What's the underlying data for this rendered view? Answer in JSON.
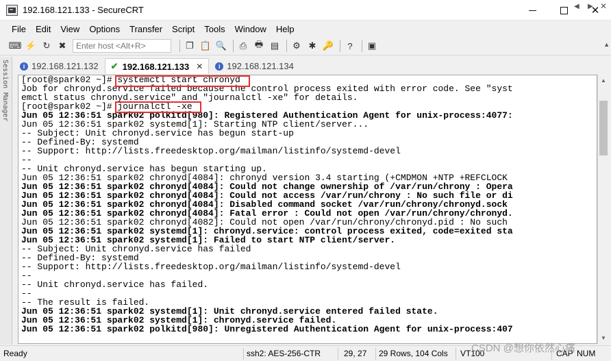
{
  "window": {
    "title": "192.168.121.133 - SecureCRT"
  },
  "menu": [
    "File",
    "Edit",
    "View",
    "Options",
    "Transfer",
    "Script",
    "Tools",
    "Window",
    "Help"
  ],
  "toolbar": {
    "host_placeholder": "Enter host <Alt+R>"
  },
  "sidebar": {
    "label": "Session Manager"
  },
  "tabs": [
    {
      "label": "192.168.121.132",
      "state": "info"
    },
    {
      "label": "192.168.121.133",
      "state": "connected"
    },
    {
      "label": "192.168.121.134",
      "state": "info"
    }
  ],
  "terminal": {
    "lines": [
      {
        "text": "[root@spark02 ~]# systemctl start chronyd",
        "bold": false
      },
      {
        "text": "Job for chronyd.service failed because the control process exited with error code. See \"syst",
        "bold": false
      },
      {
        "text": "emctl status chronyd.service\" and \"journalctl -xe\" for details.",
        "bold": false
      },
      {
        "text": "[root@spark02 ~]# journalctl -xe",
        "bold": false
      },
      {
        "text": "Jun 05 12:36:51 spark02 polkitd[980]: Registered Authentication Agent for unix-process:4077:",
        "bold": true
      },
      {
        "text": "Jun 05 12:36:51 spark02 systemd[1]: Starting NTP client/server...",
        "bold": false
      },
      {
        "text": "-- Subject: Unit chronyd.service has begun start-up",
        "bold": false
      },
      {
        "text": "-- Defined-By: systemd",
        "bold": false
      },
      {
        "text": "-- Support: http://lists.freedesktop.org/mailman/listinfo/systemd-devel",
        "bold": false
      },
      {
        "text": "--",
        "bold": false
      },
      {
        "text": "-- Unit chronyd.service has begun starting up.",
        "bold": false
      },
      {
        "text": "Jun 05 12:36:51 spark02 chronyd[4084]: chronyd version 3.4 starting (+CMDMON +NTP +REFCLOCK",
        "bold": false
      },
      {
        "text": "Jun 05 12:36:51 spark02 chronyd[4084]: Could not change ownership of /var/run/chrony : Opera",
        "bold": true
      },
      {
        "text": "Jun 05 12:36:51 spark02 chronyd[4084]: Could not access /var/run/chrony : No such file or di",
        "bold": true
      },
      {
        "text": "Jun 05 12:36:51 spark02 chronyd[4084]: Disabled command socket /var/run/chrony/chronyd.sock",
        "bold": true
      },
      {
        "text": "Jun 05 12:36:51 spark02 chronyd[4084]: Fatal error : Could not open /var/run/chrony/chronyd.",
        "bold": true
      },
      {
        "text": "Jun 05 12:36:51 spark02 chronyd[4082]: Could not open /var/run/chrony/chronyd.pid : No such",
        "bold": false
      },
      {
        "text": "Jun 05 12:36:51 spark02 systemd[1]: chronyd.service: control process exited, code=exited sta",
        "bold": true
      },
      {
        "text": "Jun 05 12:36:51 spark02 systemd[1]: Failed to start NTP client/server.",
        "bold": true
      },
      {
        "text": "-- Subject: Unit chronyd.service has failed",
        "bold": false
      },
      {
        "text": "-- Defined-By: systemd",
        "bold": false
      },
      {
        "text": "-- Support: http://lists.freedesktop.org/mailman/listinfo/systemd-devel",
        "bold": false
      },
      {
        "text": "--",
        "bold": false
      },
      {
        "text": "-- Unit chronyd.service has failed.",
        "bold": false
      },
      {
        "text": "--",
        "bold": false
      },
      {
        "text": "-- The result is failed.",
        "bold": false
      },
      {
        "text": "Jun 05 12:36:51 spark02 systemd[1]: Unit chronyd.service entered failed state.",
        "bold": true
      },
      {
        "text": "Jun 05 12:36:51 spark02 systemd[1]: chronyd.service failed.",
        "bold": true
      },
      {
        "text": "Jun 05 12:36:51 spark02 polkitd[980]: Unregistered Authentication Agent for unix-process:407",
        "bold": true
      }
    ]
  },
  "status": {
    "ready": "Ready",
    "cipher": "ssh2: AES-256-CTR",
    "cursor": "29,  27",
    "size": "29 Rows, 104 Cols",
    "term": "VT100",
    "caps": "CAP",
    "num": "NUM"
  },
  "watermark": "CSDN @想你依然心痛",
  "colors": {
    "highlight": "#e03030",
    "tab_info": "#3c64c4",
    "tab_connected": "#2c9c2c"
  }
}
